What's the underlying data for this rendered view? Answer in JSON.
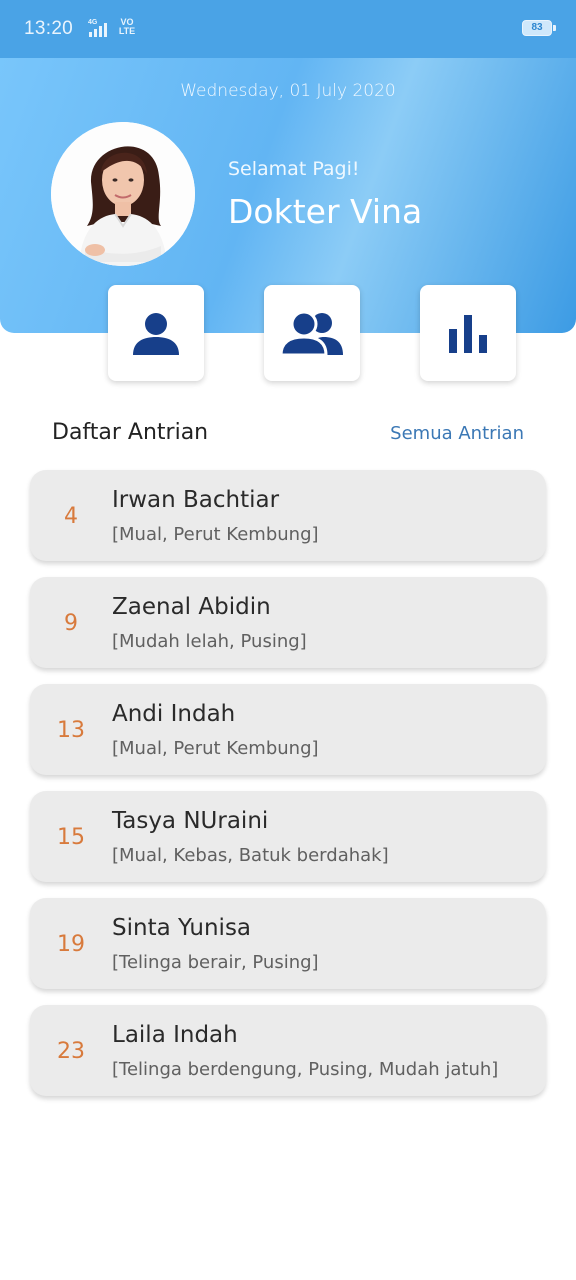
{
  "status_bar": {
    "time": "13:20",
    "network": "4G",
    "volte": "VO\nLTE",
    "battery": "83"
  },
  "header": {
    "date": "Wednesday, 01 July 2020",
    "greeting": "Selamat Pagi!",
    "doctor_name": "Dokter Vina",
    "actions": [
      {
        "icon": "person-icon"
      },
      {
        "icon": "group-icon"
      },
      {
        "icon": "bar-chart-icon"
      }
    ]
  },
  "queue_section": {
    "title": "Daftar Antrian",
    "see_all": "Semua Antrian",
    "items": [
      {
        "number": "4",
        "name": "Irwan Bachtiar",
        "symptoms": "[Mual, Perut Kembung]"
      },
      {
        "number": "9",
        "name": "Zaenal Abidin",
        "symptoms": "[Mudah lelah, Pusing]"
      },
      {
        "number": "13",
        "name": "Andi Indah",
        "symptoms": "[Mual, Perut Kembung]"
      },
      {
        "number": "15",
        "name": "Tasya NUraini",
        "symptoms": "[Mual, Kebas, Batuk berdahak]"
      },
      {
        "number": "19",
        "name": "Sinta Yunisa",
        "symptoms": "[Telinga berair, Pusing]"
      },
      {
        "number": "23",
        "name": "Laila Indah",
        "symptoms": "[Telinga berdengung, Pusing, Mudah jatuh]"
      }
    ]
  },
  "colors": {
    "header_blue": "#4aa3e6",
    "icon_navy": "#173f8a",
    "queue_number": "#d87a3c",
    "link_blue": "#3b78b5"
  }
}
